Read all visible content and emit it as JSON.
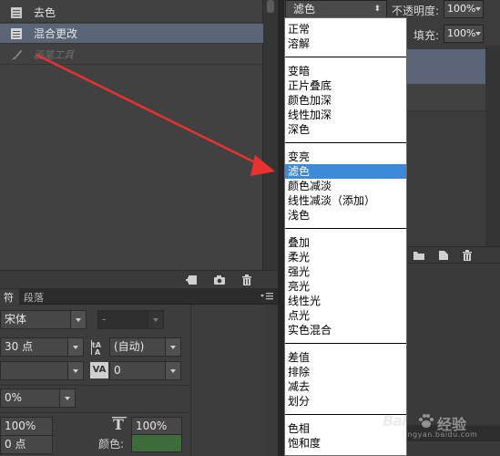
{
  "history": {
    "items": [
      {
        "label": "去色",
        "icon": "document-icon"
      },
      {
        "label": "混合更改",
        "icon": "document-icon",
        "selected": true
      },
      {
        "label": "画笔工具",
        "icon": "brush-icon",
        "ghost": true
      }
    ]
  },
  "character_panel": {
    "tabs": [
      "符",
      "段落"
    ],
    "font_family": "宋体",
    "font_style": "-",
    "font_size": "30 点",
    "leading": "(自动)",
    "kerning": "",
    "tracking": "0",
    "scale_label": "0%",
    "vertical_scale": "100%",
    "horizontal_scale": "100%",
    "baseline_shift": "0 点",
    "color_label": "颜色:",
    "color_value": "#3e6b3a"
  },
  "layers_panel": {
    "blend_mode": "滤色",
    "opacity_label": "不透明度:",
    "opacity_value": "100%",
    "fill_label": "填充:",
    "fill_value": "100%"
  },
  "blend_menu": {
    "groups": [
      [
        "正常",
        "溶解"
      ],
      [
        "变暗",
        "正片叠底",
        "颜色加深",
        "线性加深",
        "深色"
      ],
      [
        "变亮",
        "滤色",
        "颜色减淡",
        "线性减淡（添加）",
        "浅色"
      ],
      [
        "叠加",
        "柔光",
        "强光",
        "亮光",
        "线性光",
        "点光",
        "实色混合"
      ],
      [
        "差值",
        "排除",
        "减去",
        "划分"
      ],
      [
        "色相",
        "饱和度"
      ]
    ],
    "selected": "滤色"
  },
  "watermark": {
    "logo": "Bai",
    "brand": "经验",
    "url": "jingyan.baidu.com"
  },
  "colors": {
    "selection": "#5a6677",
    "menu_highlight": "#3c8ad8",
    "arrow": "#e8322f"
  }
}
